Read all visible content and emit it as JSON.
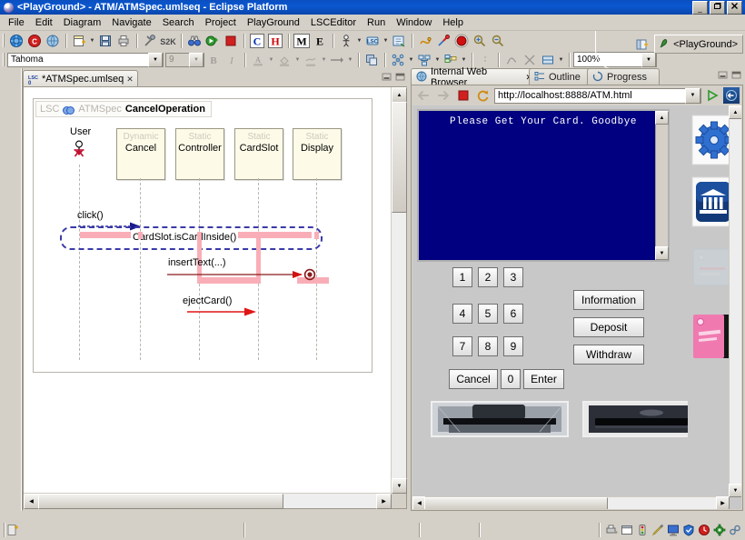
{
  "window": {
    "title": "<PlayGround> - ATM/ATMSpec.umlseq - Eclipse Platform",
    "app_icon": "eclipse-logo-icon",
    "minimize": "_",
    "maximize": "□",
    "close": "✕"
  },
  "menu": {
    "items": [
      {
        "label": "File"
      },
      {
        "label": "Edit"
      },
      {
        "label": "Diagram"
      },
      {
        "label": "Navigate"
      },
      {
        "label": "Search"
      },
      {
        "label": "Project"
      },
      {
        "label": "PlayGround"
      },
      {
        "label": "LSCEditor"
      },
      {
        "label": "Run"
      },
      {
        "label": "Window"
      },
      {
        "label": "Help"
      }
    ]
  },
  "toolbar": {
    "zoom_value": "100%",
    "font_name": "Tahoma",
    "font_size": "9",
    "buttons_row1": [
      {
        "name": "new-wizard-icon"
      },
      {
        "name": "open-resource-icon"
      },
      {
        "name": "globe-icon"
      },
      {
        "name": "new-file-icon"
      },
      {
        "name": "save-icon"
      },
      {
        "name": "print-icon"
      },
      {
        "name": "build-icon"
      },
      {
        "name": "s2k-icon"
      },
      {
        "name": "binoculars-icon"
      },
      {
        "name": "run-icon"
      },
      {
        "name": "stop-icon"
      },
      {
        "name": "c-compile-icon"
      },
      {
        "name": "h-header-icon"
      },
      {
        "name": "m-model-icon"
      },
      {
        "name": "e-execute-icon"
      }
    ],
    "buttons_row2": [
      {
        "name": "bold-icon"
      },
      {
        "name": "italic-icon"
      },
      {
        "name": "font-color-icon"
      },
      {
        "name": "fill-color-icon"
      },
      {
        "name": "line-color-icon"
      },
      {
        "name": "line-style-icon"
      },
      {
        "name": "align-icon"
      },
      {
        "name": "distribute-icon"
      },
      {
        "name": "group-icon"
      },
      {
        "name": "order-icon"
      },
      {
        "name": "route-icon"
      },
      {
        "name": "snap-icon"
      },
      {
        "name": "page-break-icon"
      }
    ],
    "perspective": {
      "label": "<PlayGround>",
      "icon": "playground-perspective-icon",
      "open_icon": "open-perspective-icon"
    }
  },
  "editor": {
    "tab_label": "*ATMSpec.umlseq",
    "tab_icon": "lsc-file-icon",
    "tab_close": "✕",
    "minimize_tooltip": "Minimize",
    "maximize_tooltip": "Maximize"
  },
  "diagram": {
    "header": {
      "prefix": "LSC",
      "middle": "ATMSpec",
      "name": "CancelOperation"
    },
    "actor": {
      "label": "User",
      "icon": "actor-stickman-icon"
    },
    "lifelines": [
      {
        "stereotype": "Dynamic",
        "name": "Cancel"
      },
      {
        "stereotype": "Static",
        "name": "Controller"
      },
      {
        "stereotype": "Static",
        "name": "CardSlot"
      },
      {
        "stereotype": "Static",
        "name": "Display"
      }
    ],
    "messages": [
      {
        "label": "click()",
        "style": "dashed-blue"
      },
      {
        "label": "CardSlot.isCardInside()",
        "style": "hot-condition"
      },
      {
        "label": "insertText(...)",
        "style": "solid-darkred"
      },
      {
        "label": "ejectCard()",
        "style": "solid-red"
      }
    ]
  },
  "views": {
    "tabs": [
      {
        "label": "Internal Web Browser",
        "icon": "browser-globe-icon",
        "active": true,
        "close": "✕"
      },
      {
        "label": "Outline",
        "icon": "outline-icon",
        "active": false
      },
      {
        "label": "Progress",
        "icon": "progress-icon",
        "active": false
      }
    ]
  },
  "browser": {
    "url": "http://localhost:8888/ATM.html",
    "back_icon": "back-arrow-icon",
    "forward_icon": "forward-arrow-icon",
    "stop_icon": "stop-icon",
    "refresh_icon": "refresh-icon",
    "go_icon": "go-arrow-icon",
    "home_icon": "home-icon"
  },
  "atm": {
    "screen_text": "Please Get Your Card. Goodbye",
    "keypad": [
      {
        "label": "1"
      },
      {
        "label": "2"
      },
      {
        "label": "3"
      },
      {
        "label": "4"
      },
      {
        "label": "5"
      },
      {
        "label": "6"
      },
      {
        "label": "7"
      },
      {
        "label": "8"
      },
      {
        "label": "9"
      },
      {
        "label": "Cancel"
      },
      {
        "label": "0"
      },
      {
        "label": "Enter"
      }
    ],
    "actions": [
      {
        "label": "Information"
      },
      {
        "label": "Deposit"
      },
      {
        "label": "Withdraw"
      }
    ],
    "devices": [
      {
        "name": "cash-dispenser-image"
      },
      {
        "name": "card-slot-image"
      }
    ],
    "side_icons": [
      {
        "name": "gear-icon"
      },
      {
        "name": "bank-building-icon"
      },
      {
        "name": "blank-card-icon"
      },
      {
        "name": "pink-card-icon"
      }
    ]
  },
  "statusbar": {
    "left_icon": "writable-indicator-icon",
    "tray_icons": [
      {
        "name": "printer-icon"
      },
      {
        "name": "window-icon"
      },
      {
        "name": "traffic-light-icon"
      },
      {
        "name": "pencil-icon"
      },
      {
        "name": "monitor-icon"
      },
      {
        "name": "shield-icon"
      },
      {
        "name": "clock-icon"
      },
      {
        "name": "gear-small-icon"
      },
      {
        "name": "link-icon"
      }
    ]
  },
  "colors": {
    "title_blue": "#0b57d0",
    "chrome": "#d4d0c8",
    "activation_pink": "#f9aeb7",
    "condition_blue": "#3a3aa8",
    "screen_navy": "#000080",
    "lifeline_cream": "#fdfbe8",
    "message_red": "#e01515",
    "message_darkred": "#8b1a1a"
  }
}
